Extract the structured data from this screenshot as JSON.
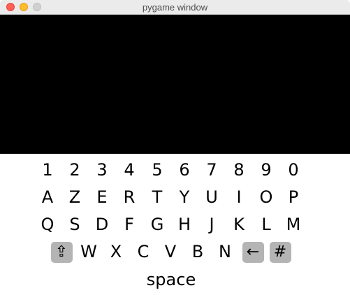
{
  "window": {
    "title": "pygame window"
  },
  "keyboard": {
    "rows": [
      [
        "1",
        "2",
        "3",
        "4",
        "5",
        "6",
        "7",
        "8",
        "9",
        "0"
      ],
      [
        "A",
        "Z",
        "E",
        "R",
        "T",
        "Y",
        "U",
        "I",
        "O",
        "P"
      ],
      [
        "Q",
        "S",
        "D",
        "F",
        "G",
        "H",
        "J",
        "K",
        "L",
        "M"
      ],
      [
        "⇪",
        "W",
        "X",
        "C",
        "V",
        "B",
        "N",
        "←",
        "#"
      ]
    ],
    "shift_label": "⇪",
    "backspace_label": "←",
    "symbols_label": "#",
    "space_label": "space"
  },
  "colors": {
    "canvas": "#000000",
    "keyboard_background": "#ffffff",
    "special_key_background": "#b4b4b4"
  }
}
